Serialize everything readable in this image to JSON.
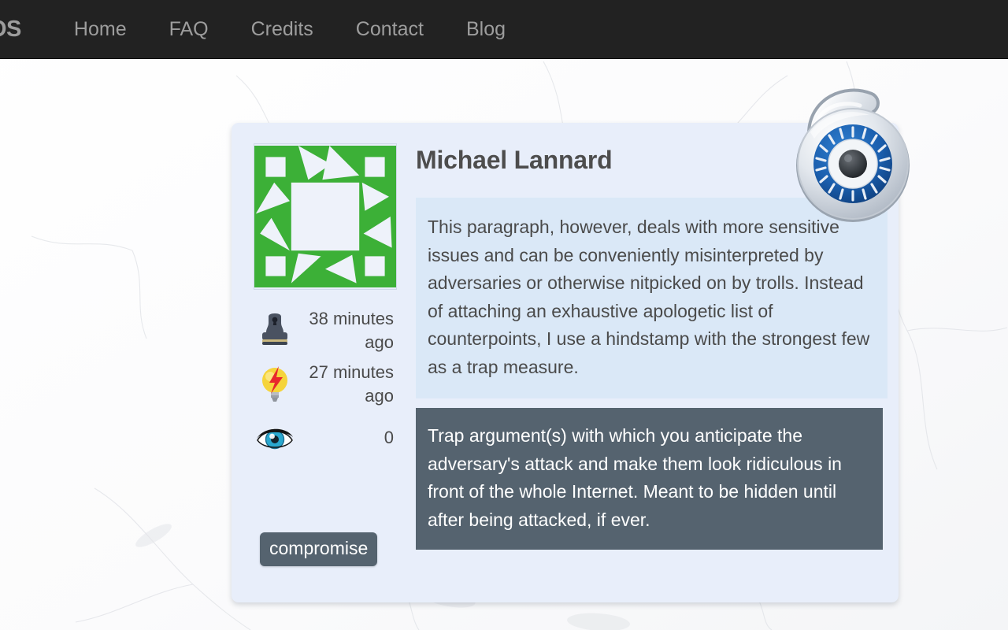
{
  "navbar": {
    "brand": "OS",
    "links": [
      {
        "label": "Home",
        "name": "nav-link-home"
      },
      {
        "label": "FAQ",
        "name": "nav-link-faq"
      },
      {
        "label": "Credits",
        "name": "nav-link-credits"
      },
      {
        "label": "Contact",
        "name": "nav-link-contact"
      },
      {
        "label": "Blog",
        "name": "nav-link-blog"
      }
    ],
    "background_color": "#222222",
    "link_color": "#9d9d9d"
  },
  "card": {
    "background_color": "#e8eefa",
    "author": {
      "name": "Michael Lannard",
      "avatar_icon": "identicon-avatar",
      "avatar_color": "#3cb037"
    },
    "meta": [
      {
        "icon": "stamp-icon",
        "label": "38 minutes ago",
        "name": "meta-stamped-time"
      },
      {
        "icon": "lightbulb-bolt-icon",
        "label": "27 minutes ago",
        "name": "meta-updated-time"
      },
      {
        "icon": "eye-icon",
        "label": "0",
        "name": "meta-view-count"
      }
    ],
    "quote": "This paragraph, however, deals with more sensitive issues and can be conveniently misinterpreted by adversaries or otherwise nitpicked on by trolls. Instead of attaching an exhaustive apologetic list of counterpoints, I use a hindstamp with the strongest few as a trap measure.",
    "quote_background_color": "#dae8f7",
    "trap": "Trap argument(s) with which you anticipate the adversary's attack and make them look ridiculous in front of the whole Internet. Meant to be hidden until after being attacked, if ever.",
    "trap_background_color": "#55636f",
    "button": {
      "label": "compromise",
      "color": "#55636f"
    }
  },
  "badge": {
    "icon": "open-padlock-eye-icon",
    "dial_color": "#1b5fae",
    "body_color": "#d4dae2"
  }
}
